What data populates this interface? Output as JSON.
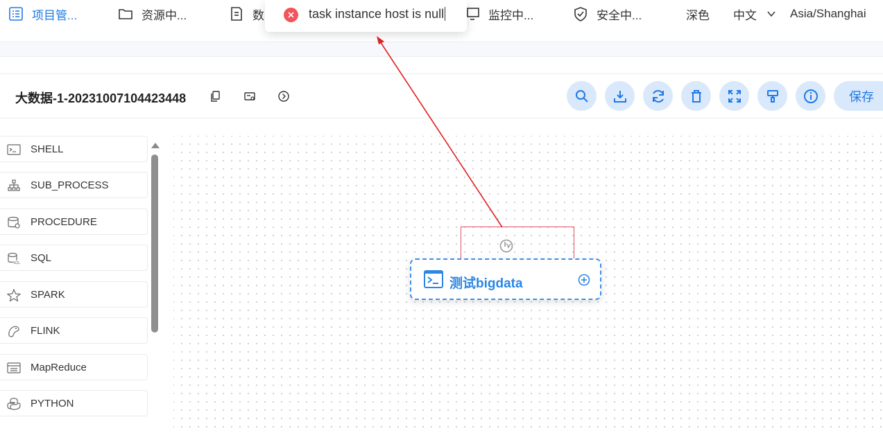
{
  "nav": {
    "project": "项目管...",
    "resource": "资源中...",
    "data": "数",
    "monitor": "监控中...",
    "security": "安全中...",
    "theme": "深色",
    "language": "中文",
    "timezone": "Asia/Shanghai"
  },
  "toast": {
    "message": "task instance host is null"
  },
  "workflow": {
    "title": "大数据-1-20231007104423448"
  },
  "toolbar": {
    "save_label": "保存"
  },
  "sidebar": {
    "items": [
      {
        "label": "SHELL",
        "icon": "shell-icon"
      },
      {
        "label": "SUB_PROCESS",
        "icon": "sub-process-icon"
      },
      {
        "label": "PROCEDURE",
        "icon": "procedure-icon"
      },
      {
        "label": "SQL",
        "icon": "sql-icon"
      },
      {
        "label": "SPARK",
        "icon": "spark-icon"
      },
      {
        "label": "FLINK",
        "icon": "flink-icon"
      },
      {
        "label": "MapReduce",
        "icon": "mapreduce-icon"
      },
      {
        "label": "PYTHON",
        "icon": "python-icon"
      }
    ]
  },
  "node": {
    "label": "测试bigdata",
    "status_icon": "task-state-icon"
  },
  "colors": {
    "accent": "#1f79e5",
    "error": "#f2545b",
    "annotation": "#e02020"
  }
}
